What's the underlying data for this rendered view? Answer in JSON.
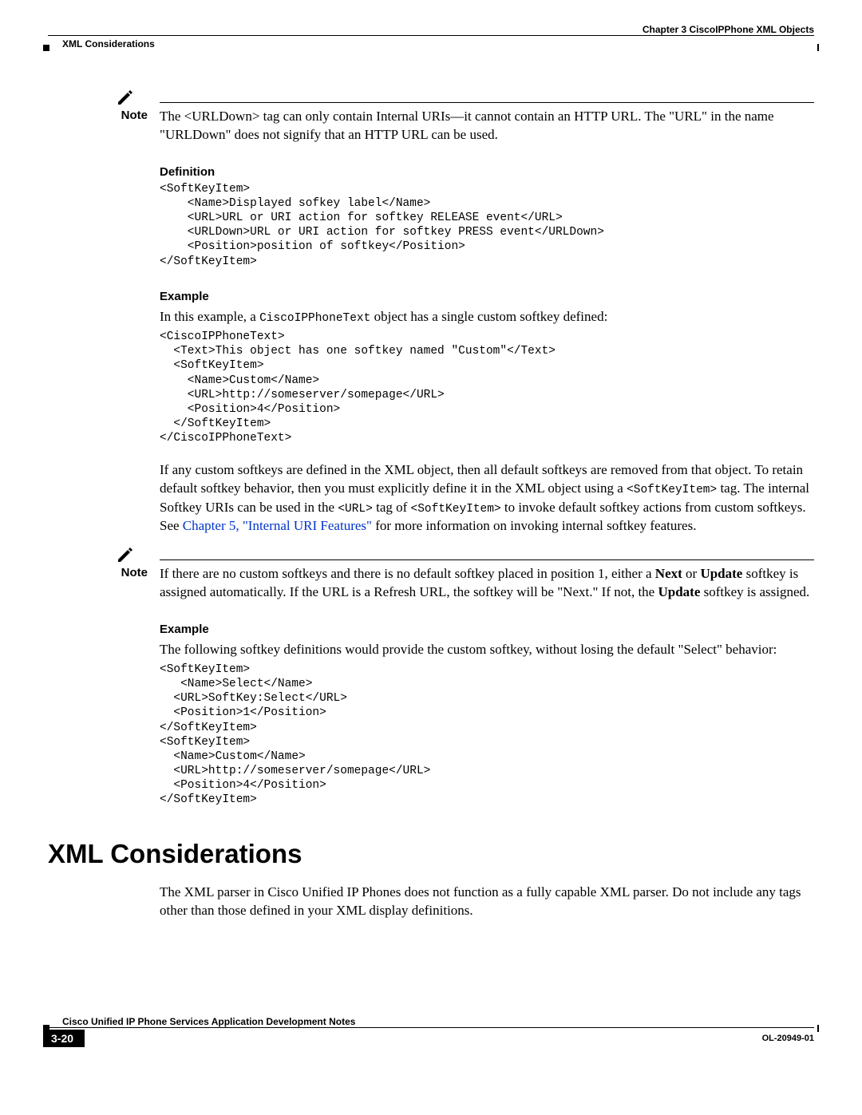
{
  "header": {
    "chapter": "Chapter 3      CiscoIPPhone XML Objects",
    "section": "XML Considerations"
  },
  "note1": {
    "label": "Note",
    "text": "The <URLDown> tag can only contain Internal URIs—it cannot contain an HTTP URL. The \"URL\" in the name \"URLDown\" does not signify that an HTTP URL can be used."
  },
  "definition": {
    "heading": "Definition",
    "code": "<SoftKeyItem>\n    <Name>Displayed sofkey label</Name>\n    <URL>URL or URI action for softkey RELEASE event</URL>\n    <URLDown>URL or URI action for softkey PRESS event</URLDown>\n    <Position>position of softkey</Position>\n</SoftKeyItem>"
  },
  "example1": {
    "heading": "Example",
    "intro_pre": "In this example, a ",
    "intro_code": "CiscoIPPhoneText",
    "intro_post": " object has a single custom softkey defined:",
    "code": "<CiscoIPPhoneText>\n  <Text>This object has one softkey named \"Custom\"</Text>\n  <SoftKeyItem>\n    <Name>Custom</Name>\n    <URL>http://someserver/somepage</URL>\n    <Position>4</Position>\n  </SoftKeyItem>\n</CiscoIPPhoneText>"
  },
  "para1": {
    "t1": "If any custom softkeys are defined in the XML object, then all default softkeys are removed from that object. To retain default softkey behavior, then you must explicitly define it in the XML object using a ",
    "c1": "<SoftKeyItem>",
    "t2": " tag. The internal Softkey URIs can be used in the ",
    "c2": "<URL>",
    "t3": " tag of ",
    "c3": "<SoftKeyItem>",
    "t4": " to invoke default softkey actions from custom softkeys. See ",
    "link": "Chapter 5, \"Internal URI Features\"",
    "t5": " for more information on invoking internal softkey features."
  },
  "note2": {
    "label": "Note",
    "t1": "If there are no custom softkeys and there is no default softkey placed in position 1, either a ",
    "b1": "Next",
    "t2": " or ",
    "b2": "Update",
    "t3": " softkey is assigned automatically. If the URL is a Refresh URL, the softkey will be \"Next.\" If not, the ",
    "b3": "Update",
    "t4": " softkey is assigned."
  },
  "example2": {
    "heading": "Example",
    "intro": "The following softkey definitions would provide the custom softkey, without losing the default \"Select\" behavior:",
    "code": "<SoftKeyItem>\n   <Name>Select</Name>\n  <URL>SoftKey:Select</URL>\n  <Position>1</Position>\n</SoftKeyItem>\n<SoftKeyItem>\n  <Name>Custom</Name>\n  <URL>http://someserver/somepage</URL>\n  <Position>4</Position>\n</SoftKeyItem>"
  },
  "h1": "XML Considerations",
  "para2": "The XML parser in Cisco Unified IP Phones does not function as a fully capable XML parser. Do not include any tags other than those defined in your XML display definitions.",
  "footer": {
    "booktitle": "Cisco Unified IP Phone Services Application Development Notes",
    "pagenum": "3-20",
    "docid": "OL-20949-01"
  }
}
